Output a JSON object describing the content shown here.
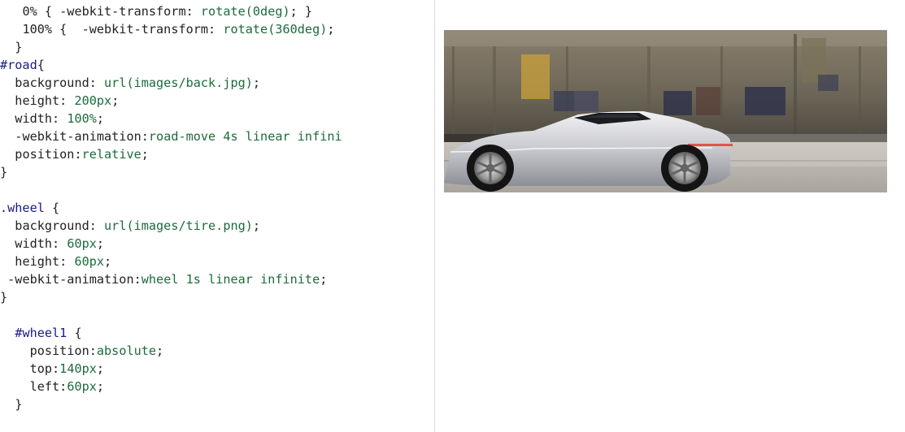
{
  "code_lines": [
    {
      "indent": "   ",
      "parts": [
        [
          "pun",
          "0% { "
        ],
        [
          "kw",
          "-webkit-transform"
        ],
        [
          "pun",
          ": "
        ],
        [
          "val",
          "rotate(0deg)"
        ],
        [
          "pun",
          "; }"
        ]
      ]
    },
    {
      "indent": "   ",
      "parts": [
        [
          "pun",
          "100% {  "
        ],
        [
          "kw",
          "-webkit-transform"
        ],
        [
          "pun",
          ": "
        ],
        [
          "val",
          "rotate(360deg)"
        ],
        [
          "pun",
          ";"
        ]
      ]
    },
    {
      "indent": "  ",
      "parts": [
        [
          "pun",
          "}"
        ]
      ]
    },
    {
      "indent": "",
      "parts": [
        [
          "sel",
          "#road"
        ],
        [
          "pun",
          "{"
        ]
      ]
    },
    {
      "indent": "  ",
      "parts": [
        [
          "kw",
          "background"
        ],
        [
          "pun",
          ": "
        ],
        [
          "val",
          "url(images/back.jpg)"
        ],
        [
          "pun",
          ";"
        ]
      ]
    },
    {
      "indent": "  ",
      "parts": [
        [
          "kw",
          "height"
        ],
        [
          "pun",
          ": "
        ],
        [
          "val",
          "200px"
        ],
        [
          "pun",
          ";"
        ]
      ]
    },
    {
      "indent": "  ",
      "parts": [
        [
          "kw",
          "width"
        ],
        [
          "pun",
          ": "
        ],
        [
          "val",
          "100%"
        ],
        [
          "pun",
          ";"
        ]
      ]
    },
    {
      "indent": "  ",
      "parts": [
        [
          "kw",
          "-webkit-animation"
        ],
        [
          "pun",
          ":"
        ],
        [
          "val",
          "road-move 4s linear infini"
        ]
      ]
    },
    {
      "indent": "  ",
      "parts": [
        [
          "kw",
          "position"
        ],
        [
          "pun",
          ":"
        ],
        [
          "val",
          "relative"
        ],
        [
          "pun",
          ";"
        ]
      ]
    },
    {
      "indent": "",
      "parts": [
        [
          "pun",
          "}"
        ]
      ]
    },
    {
      "indent": "",
      "parts": []
    },
    {
      "indent": "",
      "parts": [
        [
          "sel",
          ".wheel"
        ],
        [
          "pun",
          " {"
        ]
      ]
    },
    {
      "indent": "  ",
      "parts": [
        [
          "kw",
          "background"
        ],
        [
          "pun",
          ": "
        ],
        [
          "val",
          "url(images/tire.png)"
        ],
        [
          "pun",
          ";"
        ]
      ]
    },
    {
      "indent": "  ",
      "parts": [
        [
          "kw",
          "width"
        ],
        [
          "pun",
          ": "
        ],
        [
          "val",
          "60px"
        ],
        [
          "pun",
          ";"
        ]
      ]
    },
    {
      "indent": "  ",
      "parts": [
        [
          "kw",
          "height"
        ],
        [
          "pun",
          ": "
        ],
        [
          "val",
          "60px"
        ],
        [
          "pun",
          ";"
        ]
      ]
    },
    {
      "indent": " ",
      "parts": [
        [
          "kw",
          "-webkit-animation"
        ],
        [
          "pun",
          ":"
        ],
        [
          "val",
          "wheel 1s linear infinite"
        ],
        [
          "pun",
          ";"
        ]
      ]
    },
    {
      "indent": "",
      "parts": [
        [
          "pun",
          "}"
        ]
      ]
    },
    {
      "indent": "",
      "parts": []
    },
    {
      "indent": "  ",
      "parts": [
        [
          "sel",
          "#wheel1"
        ],
        [
          "pun",
          " {"
        ]
      ]
    },
    {
      "indent": "    ",
      "parts": [
        [
          "kw",
          "position"
        ],
        [
          "pun",
          ":"
        ],
        [
          "val",
          "absolute"
        ],
        [
          "pun",
          ";"
        ]
      ]
    },
    {
      "indent": "    ",
      "parts": [
        [
          "kw",
          "top"
        ],
        [
          "pun",
          ":"
        ],
        [
          "val",
          "140px"
        ],
        [
          "pun",
          ";"
        ]
      ]
    },
    {
      "indent": "    ",
      "parts": [
        [
          "kw",
          "left"
        ],
        [
          "pun",
          ":"
        ],
        [
          "val",
          "60px"
        ],
        [
          "pun",
          ";"
        ]
      ]
    },
    {
      "indent": "  ",
      "parts": [
        [
          "pun",
          "}"
        ]
      ]
    }
  ],
  "colors": {
    "selector": "#1a1a8c",
    "property": "#222222",
    "value": "#1c6b3c",
    "background": "#ffffff",
    "divider": "#d9d9d9"
  },
  "preview": {
    "scene": "road-scene-image",
    "car_color": "silver"
  }
}
